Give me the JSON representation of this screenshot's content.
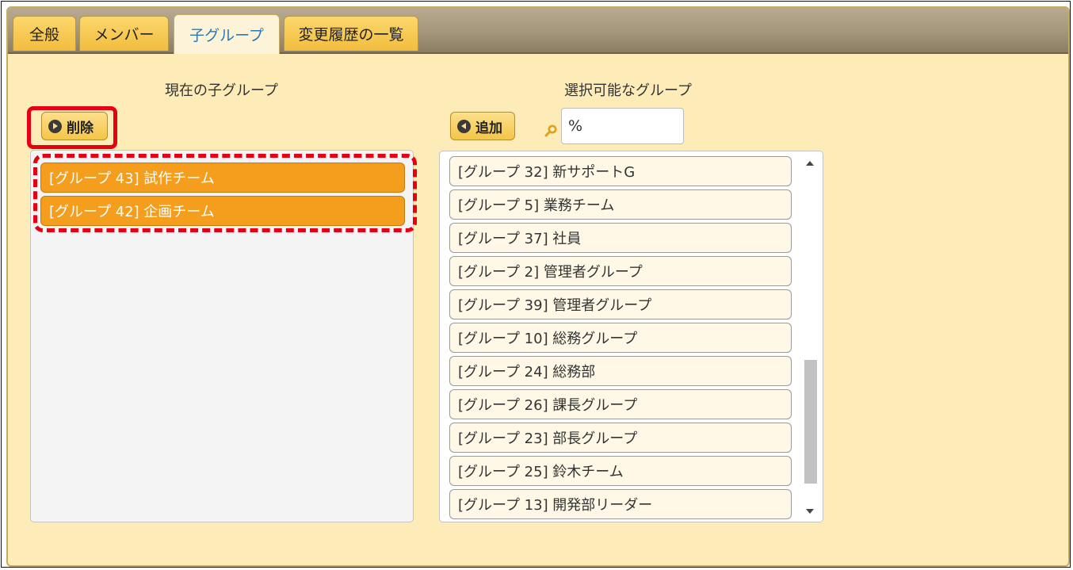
{
  "tabs": [
    {
      "label": "全般",
      "active": false
    },
    {
      "label": "メンバー",
      "active": false
    },
    {
      "label": "子グループ",
      "active": true
    },
    {
      "label": "変更履歴の一覧",
      "active": false
    }
  ],
  "current": {
    "title": "現在の子グループ",
    "delete_label": "削除",
    "items": [
      "[グループ 43] 試作チーム",
      "[グループ 42] 企画チーム"
    ]
  },
  "available": {
    "title": "選択可能なグループ",
    "add_label": "追加",
    "search_value": "%",
    "items": [
      "[グループ 32] 新サポートG",
      "[グループ 5] 業務チーム",
      "[グループ 37] 社員",
      "[グループ 2] 管理者グループ",
      "[グループ 39] 管理者グループ",
      "[グループ 10] 総務グループ",
      "[グループ 24] 総務部",
      "[グループ 26] 課長グループ",
      "[グループ 23] 部長グループ",
      "[グループ 25] 鈴木チーム",
      "[グループ 13] 開発部リーダー"
    ]
  },
  "colors": {
    "highlight": "#e60012",
    "selected_item": "#f59d1c",
    "panel_bg": "#fdebb8",
    "tab_active_text": "#2c78b5"
  }
}
